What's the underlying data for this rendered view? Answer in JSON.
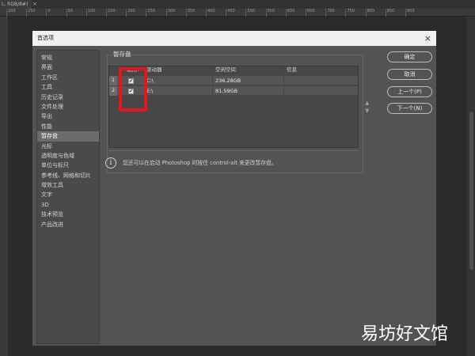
{
  "doc_tab": {
    "title": "L, RGB/8#)",
    "close": "×"
  },
  "ruler": {
    "ticks": [
      "200",
      "250",
      "0",
      "50",
      "100",
      "150",
      "200",
      "250",
      "300",
      "350",
      "400",
      "450",
      "500",
      "550",
      "600",
      "650",
      "700",
      "750",
      "800",
      "850",
      "900"
    ]
  },
  "dialog": {
    "title": "首选项",
    "close": "×",
    "nav": [
      "常规",
      "界面",
      "工作区",
      "工具",
      "历史记录",
      "文件处理",
      "导出",
      "性能",
      "暂存盘",
      "光标",
      "透明度与色域",
      "单位与标尺",
      "参考线、网格和切片",
      "增效工具",
      "文字",
      "3D",
      "技术预览",
      "产品改进"
    ],
    "active_index": 8,
    "panel_title": "暂存盘",
    "table": {
      "headers": [
        "现用?",
        "驱动器",
        "空闲空间",
        "信息"
      ],
      "rows": [
        {
          "num": "1",
          "checked": "✔",
          "drive": "C:\\",
          "free": "236.28GB",
          "info": ""
        },
        {
          "num": "2",
          "checked": "✔",
          "drive": "E:\\",
          "free": "81.59GB",
          "info": ""
        }
      ]
    },
    "arrows": {
      "up": "▲",
      "down": "▼"
    },
    "info_icon": "i",
    "info_text": "您还可以在启动 Photoshop 时按住 control-alt 来更改暂存盘。",
    "buttons": {
      "ok": "确定",
      "cancel": "取消",
      "prev": "上一个(P)",
      "next": "下一个(N)"
    }
  },
  "watermark": "易坊好文馆",
  "colors": {
    "highlight": "#e0181d",
    "dialog_bg": "#535353",
    "app_bg": "#2b2b2b"
  }
}
